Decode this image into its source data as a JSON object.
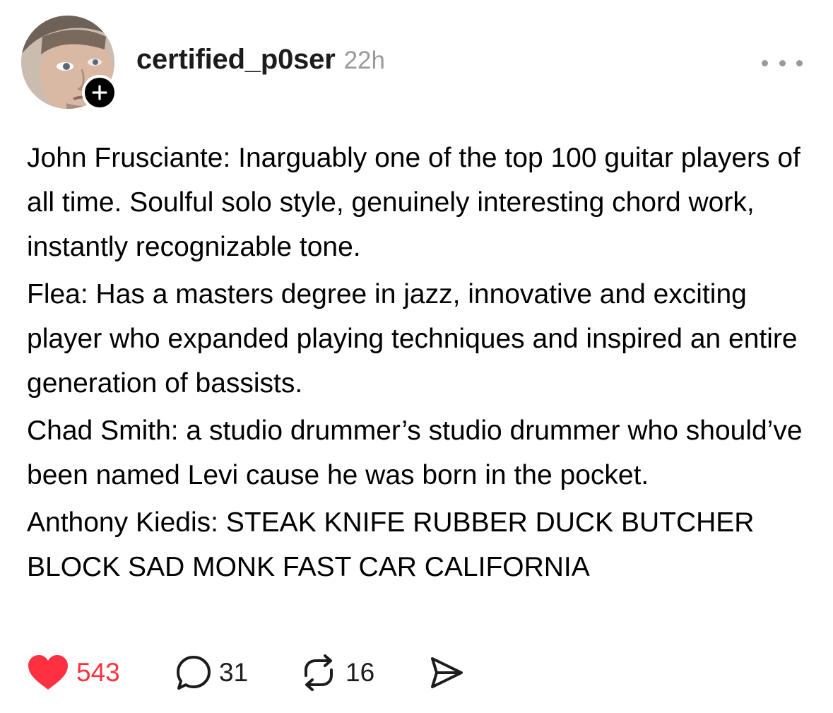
{
  "post": {
    "author": {
      "username": "certified_p0ser",
      "avatar_alt": "avatar",
      "follow_icon": "plus-icon"
    },
    "time_ago": "22h",
    "more_icon": "more-horizontal-icon",
    "paragraphs": [
      "John Frusciante: Inarguably one of the top 100 guitar players of all time. Soulful solo style, genuinely interesting chord work, instantly recognizable tone.",
      "Flea: Has a masters degree in jazz, innovative and exciting player who expanded playing techniques and inspired an entire generation of bassists.",
      "Chad Smith: a studio drummer’s studio drummer who should’ve been named Levi cause he was born in the pocket.",
      "Anthony Kiedis: STEAK KNIFE RUBBER DUCK BUTCHER BLOCK SAD MONK FAST CAR CALIFORNIA"
    ],
    "actions": {
      "likes": "543",
      "replies": "31",
      "reposts": "16",
      "like_icon": "heart-filled-icon",
      "reply_icon": "speech-bubble-icon",
      "repost_icon": "repost-icon",
      "share_icon": "send-icon"
    },
    "colors": {
      "like": "#ff3040",
      "muted": "#9a9a9a",
      "text": "#000000"
    }
  }
}
